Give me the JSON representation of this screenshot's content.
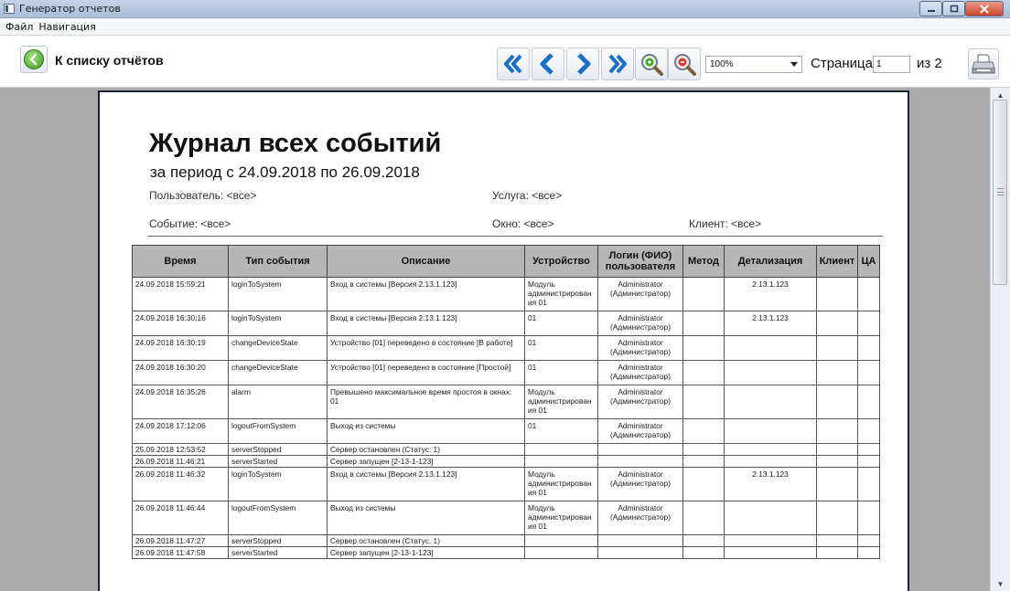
{
  "window": {
    "title": "Генератор отчетов"
  },
  "menu": {
    "items": [
      "Файл",
      "Навигация"
    ]
  },
  "toolbar": {
    "back_label": "К списку отчётов",
    "zoom_value": "100%",
    "page_label": "Страница",
    "page_current": "1",
    "page_total": "из 2"
  },
  "colors": {
    "accent": "#1c6fc7",
    "header_bg": "#b6b6b6",
    "page_border": "#1a1f3a"
  },
  "report": {
    "title": "Журнал всех событий",
    "period": "за период с 24.09.2018 по 26.09.2018",
    "user": "Пользователь: <все>",
    "service": "Услуга: <все>",
    "event": "Событие: <все>",
    "window": "Окно: <все>",
    "client": "Клиент: <все>",
    "columns": [
      "Время",
      "Тип события",
      "Описание",
      "Устройство",
      "Логин (ФИО) пользователя",
      "Метод",
      "Детализация",
      "Клиент",
      "ЦА"
    ],
    "rows": [
      [
        "24.09.2018 15:59:21",
        "loginToSystem",
        "Вход в системы [Версия 2.13.1.123]",
        "Модуль администрирован ия 01",
        "Administrator (Администратор)",
        "",
        "2.13.1.123",
        "",
        ""
      ],
      [
        "24.09.2018 16:30:16",
        "loginToSystem",
        "Вход в системы [Версия 2.13.1.123]",
        "01",
        "Administrator (Администратор)",
        "",
        "2.13.1.123",
        "",
        ""
      ],
      [
        "24.09.2018 16:30:19",
        "changeDeviceState",
        "Устройство [01] переведено в состояние [В работе]",
        "01",
        "Administrator (Администратор)",
        "",
        "",
        "",
        ""
      ],
      [
        "24.09.2018 16:30:20",
        "changeDeviceState",
        "Устройство [01] переведено в состояние [Простой]",
        "01",
        "Administrator (Администратор)",
        "",
        "",
        "",
        ""
      ],
      [
        "24.09.2018 16:35:26",
        "alarm",
        "Превышено максимальное время простоя в окнах: 01",
        "Модуль администрирован ия 01",
        "Administrator (Администратор)",
        "",
        "",
        "",
        ""
      ],
      [
        "24.09.2018 17:12:06",
        "logoutFromSystem",
        "Выход из системы",
        "01",
        "Administrator (Администратор)",
        "",
        "",
        "",
        ""
      ],
      [
        "25.09.2018 12:53:52",
        "serverStopped",
        "Сервер остановлен (Статус: 1)",
        "",
        "",
        "",
        "",
        "",
        ""
      ],
      [
        "26.09.2018 11:46:21",
        "serverStarted",
        "Сервер запущен [2-13-1-123]",
        "",
        "",
        "",
        "",
        "",
        ""
      ],
      [
        "26.09.2018 11:46:32",
        "loginToSystem",
        "Вход в системы [Версия 2.13.1.123]",
        "Модуль администрирован ия 01",
        "Administrator (Администратор)",
        "",
        "2.13.1.123",
        "",
        ""
      ],
      [
        "26.09.2018 11:46:44",
        "logoutFromSystem",
        "Выход из системы",
        "Модуль администрирован ия 01",
        "Administrator (Администратор)",
        "",
        "",
        "",
        ""
      ],
      [
        "26.09.2018 11:47:27",
        "serverStopped",
        "Сервер остановлен (Статус: 1)",
        "",
        "",
        "",
        "",
        "",
        ""
      ],
      [
        "26.09.2018 11:47:58",
        "serverStarted",
        "Сервер запущен [2-13-1-123]",
        "",
        "",
        "",
        "",
        "",
        ""
      ]
    ]
  },
  "icons": {
    "back": "arrow-left-circle-icon",
    "first": "double-chevron-left-icon",
    "prev": "chevron-left-icon",
    "next": "chevron-right-icon",
    "last": "double-chevron-right-icon",
    "zoom_in": "zoom-in-icon",
    "zoom_out": "zoom-out-icon",
    "print": "printer-icon"
  }
}
